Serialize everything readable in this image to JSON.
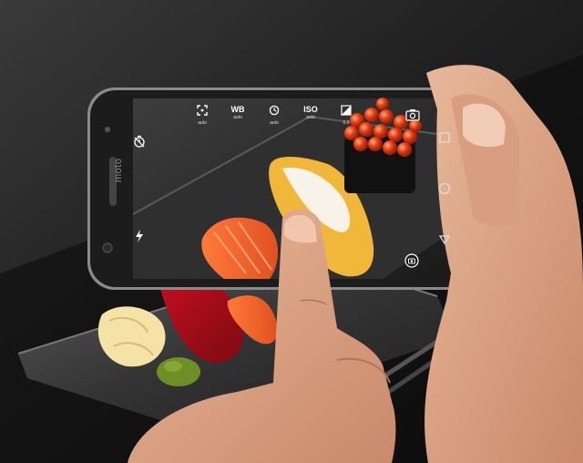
{
  "phone": {
    "brand": "moto"
  },
  "camera_ui": {
    "controls": [
      {
        "icon": "focus-icon",
        "label": "",
        "value": "auto"
      },
      {
        "icon": "white-balance-icon",
        "label": "WB",
        "value": "auto"
      },
      {
        "icon": "shutter-speed-icon",
        "label": "",
        "value": "auto"
      },
      {
        "icon": "iso-icon",
        "label": "ISO",
        "value": "auto"
      },
      {
        "icon": "exposure-icon",
        "label": "",
        "value": "0.0"
      }
    ],
    "side_icons": [
      "timer-icon",
      "flash-icon",
      "camera-switch-icon",
      "gallery-icon"
    ],
    "nav_icons": [
      "square-icon",
      "circle-icon",
      "triangle-icon"
    ]
  }
}
